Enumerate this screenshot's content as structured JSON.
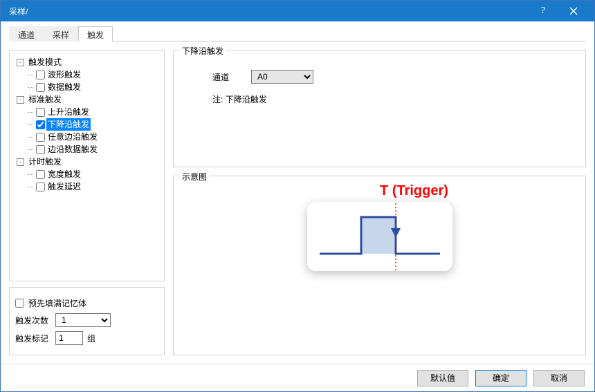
{
  "window": {
    "title": "采样/"
  },
  "tabs": [
    {
      "label": "通道",
      "active": false
    },
    {
      "label": "采样",
      "active": false
    },
    {
      "label": "触发",
      "active": true
    }
  ],
  "tree": {
    "groups": [
      {
        "label": "触发模式",
        "children": [
          {
            "label": "波形触发",
            "checked": false,
            "selected": false
          },
          {
            "label": "数据触发",
            "checked": false,
            "selected": false
          }
        ]
      },
      {
        "label": "标准触发",
        "children": [
          {
            "label": "上升沿触发",
            "checked": false,
            "selected": false
          },
          {
            "label": "下降沿触发",
            "checked": true,
            "selected": true
          },
          {
            "label": "任意边沿触发",
            "checked": false,
            "selected": false
          },
          {
            "label": "边沿数据触发",
            "checked": false,
            "selected": false
          }
        ]
      },
      {
        "label": "计时触发",
        "children": [
          {
            "label": "宽度触发",
            "checked": false,
            "selected": false
          },
          {
            "label": "触发延迟",
            "checked": false,
            "selected": false
          }
        ]
      }
    ]
  },
  "bottom": {
    "prefill_label": "预先填满记忆体",
    "prefill_checked": false,
    "count_label": "触发次数",
    "count_value": "1",
    "mark_label": "触发标记",
    "mark_value": "1",
    "mark_unit": "组"
  },
  "config": {
    "group_title": "下降沿触发",
    "channel_label": "通道",
    "channel_value": "A0",
    "note_label": "注:",
    "note_value": "下降沿触发"
  },
  "diagram": {
    "group_title": "示意图",
    "trigger_label": "T (Trigger)"
  },
  "footer": {
    "defaults": "默认值",
    "ok": "确定",
    "cancel": "取消"
  }
}
